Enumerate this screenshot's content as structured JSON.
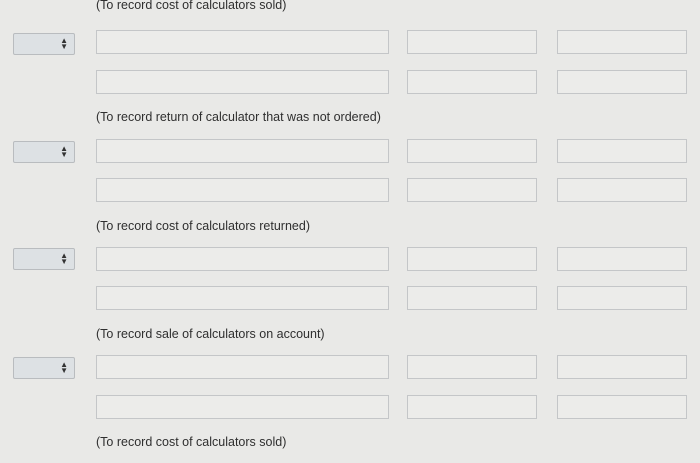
{
  "entries": [
    {
      "note": "(To record return of calculator that was not ordered)"
    },
    {
      "note": "(To record cost of calculators returned)"
    },
    {
      "note": "(To record sale of calculators on account)"
    },
    {
      "note": "(To record cost of calculators sold)"
    }
  ],
  "top_note": "(To record cost of calculators sold)",
  "icons": {
    "select_arrows": "up-down-chevron-icon"
  }
}
